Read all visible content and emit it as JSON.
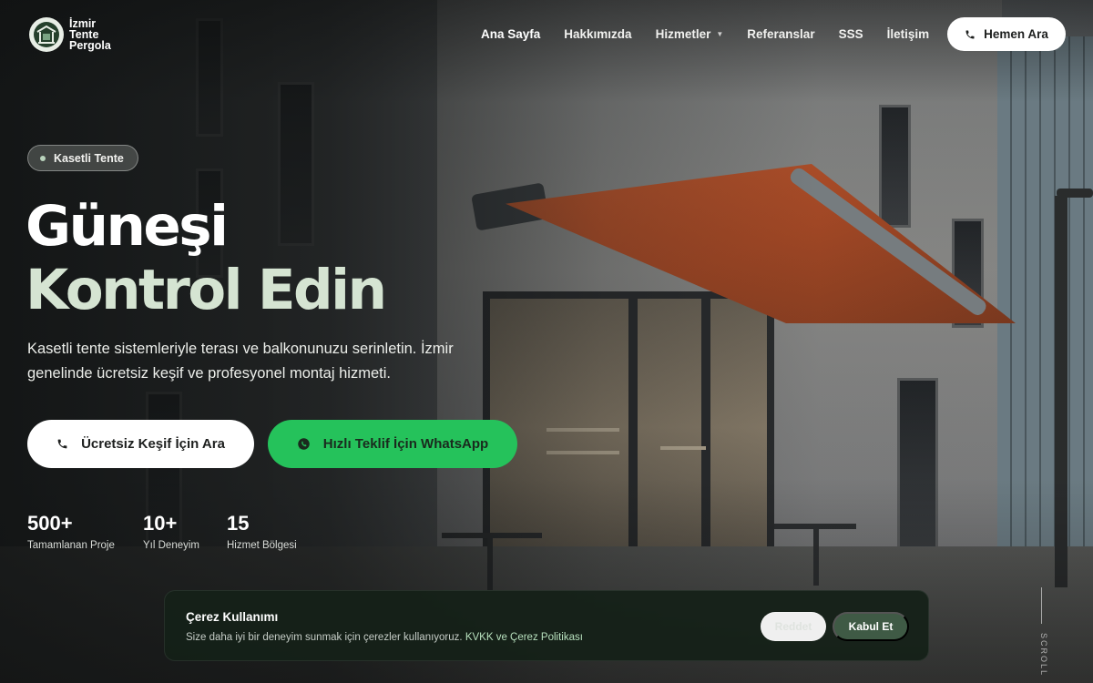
{
  "brand": {
    "line1": "İzmir",
    "line2": "Tente",
    "line3": "Pergola",
    "icon": "logo-pergola-icon"
  },
  "nav": {
    "items": [
      {
        "label": "Ana Sayfa",
        "active": true
      },
      {
        "label": "Hakkımızda",
        "active": false
      },
      {
        "label": "Hizmetler",
        "active": false,
        "has_dropdown": true
      },
      {
        "label": "Referanslar",
        "active": false
      },
      {
        "label": "SSS",
        "active": false
      },
      {
        "label": "İletişim",
        "active": false
      }
    ],
    "call_button": "Hemen Ara",
    "call_icon": "phone-icon"
  },
  "hero": {
    "badge": "Kasetli Tente",
    "title_line1": "Güneşi",
    "title_line2": "Kontrol Edin",
    "lead": "Kasetli tente sistemleriyle terası ve balkonunuzu serinletin. İzmir genelinde ücretsiz keşif ve profesyonel montaj hizmeti.",
    "primary_button": "Ücretsiz Keşif İçin Ara",
    "secondary_button": "Hızlı Teklif İçin WhatsApp"
  },
  "stats": [
    {
      "value": "500+",
      "label": "Tamamlanan Proje"
    },
    {
      "value": "10+",
      "label": "Yıl Deneyim"
    },
    {
      "value": "15",
      "label": "Hizmet Bölgesi"
    }
  ],
  "cookie": {
    "title": "Çerez Kullanımı",
    "text": "Size daha iyi bir deneyim sunmak için çerezler kullanıyoruz.",
    "link": "KVKK ve Çerez Politikası",
    "reject": "Reddet",
    "accept": "Kabul Et"
  },
  "scroll_hint": "SCROLL",
  "colors": {
    "accent_green": "#d5e4d2",
    "whatsapp_green": "#25c25b",
    "cookie_bg": "#142018",
    "awning": "#b3502a"
  }
}
